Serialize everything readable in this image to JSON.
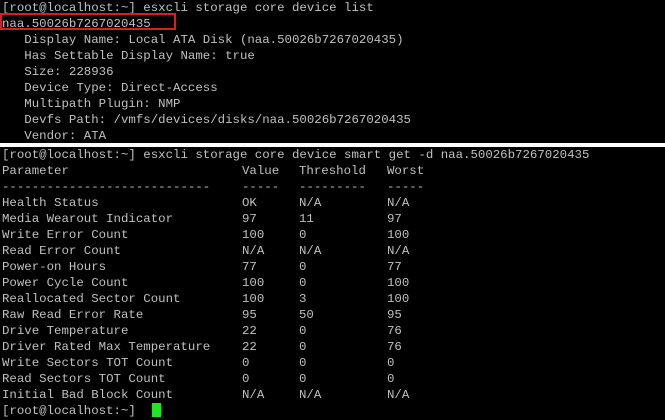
{
  "terminal": {
    "top": {
      "command": "[root@localhost:~] esxcli storage core device list",
      "device_id": "naa.50026b7267020435",
      "details": [
        "   Display Name: Local ATA Disk (naa.50026b7267020435)",
        "   Has Settable Display Name: true",
        "   Size: 228936",
        "   Device Type: Direct-Access",
        "   Multipath Plugin: NMP",
        "   Devfs Path: /vmfs/devices/disks/naa.50026b7267020435",
        "   Vendor: ATA"
      ]
    },
    "bottom": {
      "command": "[root@localhost:~] esxcli storage core device smart get -d naa.50026b7267020435",
      "headers": [
        "Parameter",
        "Value",
        "Threshold",
        "Worst"
      ],
      "separators": [
        "----------------------------",
        "-----",
        "---------",
        "-----"
      ],
      "rows": [
        [
          "Health Status",
          "OK",
          "N/A",
          "N/A"
        ],
        [
          "Media Wearout Indicator",
          "97",
          "11",
          "97"
        ],
        [
          "Write Error Count",
          "100",
          "0",
          "100"
        ],
        [
          "Read Error Count",
          "N/A",
          "N/A",
          "N/A"
        ],
        [
          "Power-on Hours",
          "77",
          "0",
          "77"
        ],
        [
          "Power Cycle Count",
          "100",
          "0",
          "100"
        ],
        [
          "Reallocated Sector Count",
          "100",
          "3",
          "100"
        ],
        [
          "Raw Read Error Rate",
          "95",
          "50",
          "95"
        ],
        [
          "Drive Temperature",
          "22",
          "0",
          "76"
        ],
        [
          "Driver Rated Max Temperature",
          "22",
          "0",
          "76"
        ],
        [
          "Write Sectors TOT Count",
          "0",
          "0",
          "0"
        ],
        [
          "Read Sectors TOT Count",
          "0",
          "0",
          "0"
        ],
        [
          "Initial Bad Block Count",
          "N/A",
          "N/A",
          "N/A"
        ]
      ],
      "prompt": "[root@localhost:~] "
    }
  },
  "colors": {
    "background": "#000000",
    "text": "#c0c0c0",
    "highlight_border": "#d42020",
    "cursor": "#22e622",
    "divider": "#ffffff"
  }
}
